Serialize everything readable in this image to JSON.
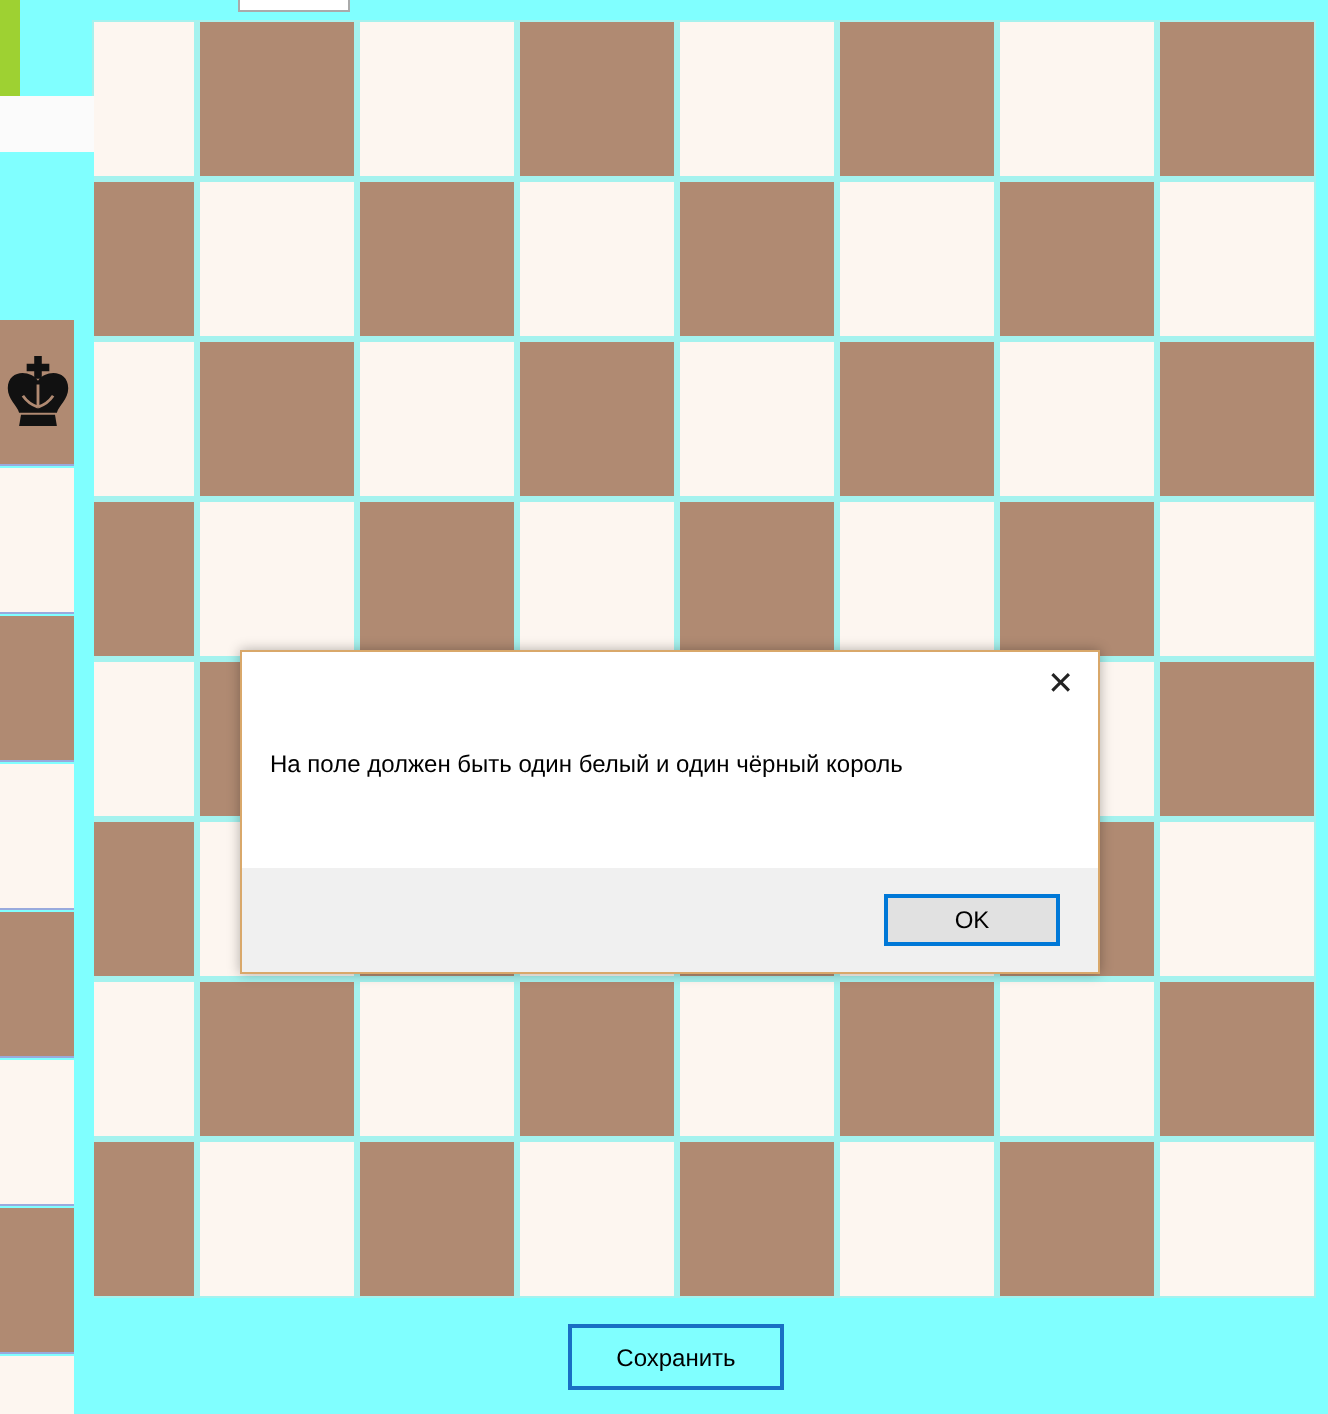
{
  "palette": [
    {
      "kind": "black-king"
    },
    {
      "kind": "empty"
    },
    {
      "kind": "empty"
    },
    {
      "kind": "empty"
    },
    {
      "kind": "empty"
    },
    {
      "kind": "empty"
    },
    {
      "kind": "empty"
    },
    {
      "kind": "empty"
    }
  ],
  "save_button": "Сохранить",
  "dialog": {
    "close": "✕",
    "message": "На поле должен быть один белый и один чёрный король",
    "ok_button": "OK"
  }
}
